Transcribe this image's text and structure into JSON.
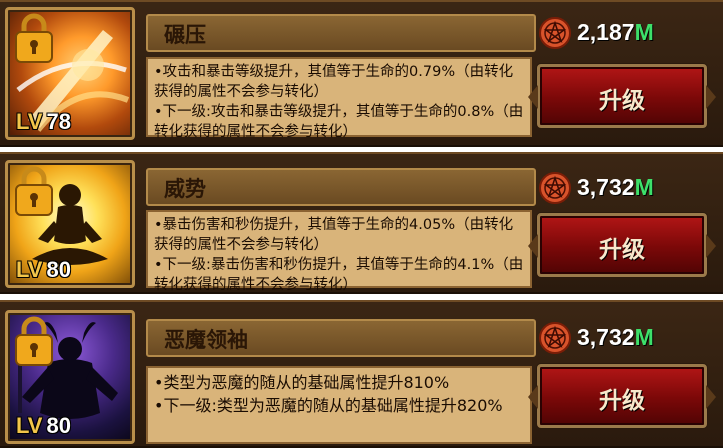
{
  "skills": [
    {
      "name": "碾压",
      "level_prefix": "LV",
      "level": "78",
      "cost_amount": "2,187",
      "cost_unit": "M",
      "desc_line1": "•攻击和暴击等级提升，其值等于生命的0.79%（由转化获得的属性不会参与转化）",
      "desc_line2": "•下一级:攻击和暴击等级提升，其值等于生命的0.8%（由转化获得的属性不会参与转化）",
      "upgrade_label": "升级",
      "icon": "slash-skill-icon"
    },
    {
      "name": "威势",
      "level_prefix": "LV",
      "level": "80",
      "cost_amount": "3,732",
      "cost_unit": "M",
      "desc_line1": "•暴击伤害和秒伤提升，其值等于生命的4.05%（由转化获得的属性不会参与转化）",
      "desc_line2": "•下一级:暴击伤害和秒伤提升，其值等于生命的4.1%（由转化获得的属性不会参与转化）",
      "upgrade_label": "升级",
      "icon": "meditation-skill-icon"
    },
    {
      "name": "恶魔领袖",
      "level_prefix": "LV",
      "level": "80",
      "cost_amount": "3,732",
      "cost_unit": "M",
      "desc_line1": "•类型为恶魔的随从的基础属性提升810%",
      "desc_line2": "•下一级:类型为恶魔的随从的基础属性提升820%",
      "upgrade_label": "升级",
      "icon": "demon-skill-icon"
    }
  ],
  "colors": {
    "panel_bg": "#2a1a0d",
    "desc_bg": "#d9b47a",
    "button_red": "#9a0c0c",
    "unit_green": "#3de06a",
    "level_gold": "#f3c64a"
  }
}
